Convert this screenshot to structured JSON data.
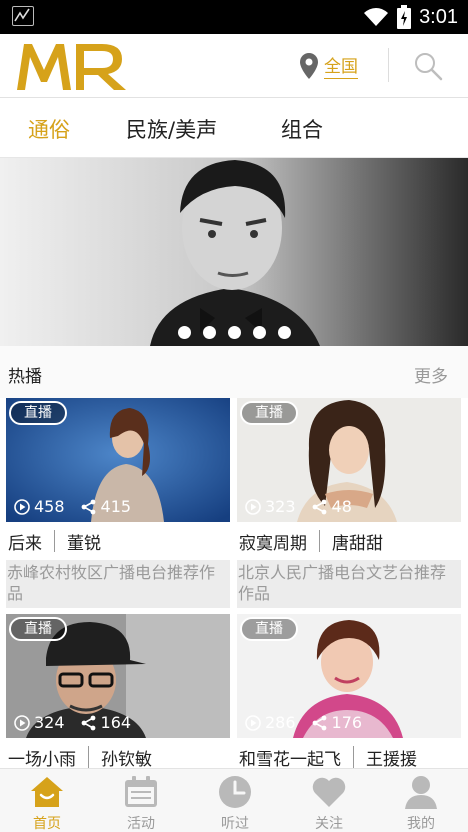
{
  "status_bar": {
    "time": "3:01",
    "icons": [
      "app-notification-icon",
      "wifi-icon",
      "battery-icon"
    ]
  },
  "header": {
    "logo_text": "MR",
    "location_label": "全国",
    "icons": {
      "location": "location-pin-icon",
      "search": "search-icon"
    }
  },
  "tabs": [
    {
      "label": "通俗",
      "active": true
    },
    {
      "label": "民族/美声",
      "active": false
    },
    {
      "label": "组合",
      "active": false
    }
  ],
  "banner": {
    "dot_count": 5,
    "active_dot": 0
  },
  "section": {
    "title": "热播",
    "more": "更多"
  },
  "cards": [
    {
      "badge": "直播",
      "plays": "458",
      "shares": "415",
      "song": "后来",
      "singer": "董锐",
      "desc": "赤峰农村牧区广播电台推荐作品"
    },
    {
      "badge": "直播",
      "plays": "323",
      "shares": "48",
      "song": "寂寞周期",
      "singer": "唐甜甜",
      "desc": "北京人民广播电台文艺台推荐作品"
    },
    {
      "badge": "直播",
      "plays": "324",
      "shares": "164",
      "song": "一场小雨",
      "singer": "孙钦敏",
      "desc": ""
    },
    {
      "badge": "直播",
      "plays": "286",
      "shares": "176",
      "song": "和雪花一起飞",
      "singer": "王援援",
      "desc": ""
    }
  ],
  "bottom_nav": [
    {
      "label": "首页",
      "icon": "home-icon",
      "active": true
    },
    {
      "label": "活动",
      "icon": "calendar-icon",
      "active": false
    },
    {
      "label": "听过",
      "icon": "clock-icon",
      "active": false
    },
    {
      "label": "关注",
      "icon": "heart-icon",
      "active": false
    },
    {
      "label": "我的",
      "icon": "user-icon",
      "active": false
    }
  ],
  "colors": {
    "accent": "#d6a21a",
    "inactive": "#b9b9b9",
    "status_bar": "#000000"
  }
}
